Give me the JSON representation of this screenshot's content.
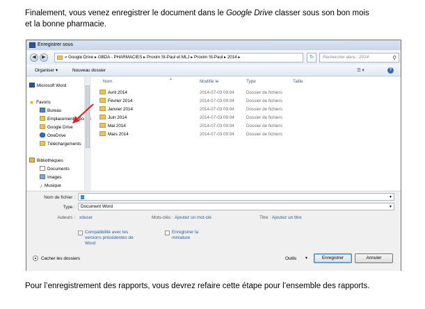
{
  "intro": {
    "line1_a": "Finalement, vous venez enregistrer le document dans le ",
    "line1_em": "Google Drive",
    "line1_b": " classer sous son bon mois",
    "line2": "et la bonne pharmacie."
  },
  "outro": "Pour l’enregistrement des rapports, vous devrez refaire cette étape pour l’ensemble des rapports.",
  "dialog": {
    "title": "Enregistrer sous",
    "address_path": "«  Google Drive  ▸  GBDA - PHARMACIES  ▸  Proxim St-Paul et MLJ  ▸  Proxim St-Paul  ▸  2014  ▸",
    "search_placeholder": "Rechercher dans : 2014",
    "toolbar": {
      "organize": "Organiser ▾",
      "new_folder": "Nouveau dossier"
    },
    "nav": {
      "word": "Microsoft Word",
      "favorites": "Favoris",
      "desktop": "Bureau",
      "recent": "Emplacements récents",
      "gdrive": "Google Drive",
      "onedrive": "OneDrive",
      "downloads": "Téléchargements",
      "libraries": "Bibliothèques",
      "documents": "Documents",
      "images": "Images",
      "music": "Musique"
    },
    "columns": {
      "name": "Nom",
      "modified": "Modifié le",
      "type": "Type",
      "size": "Taille"
    },
    "files": [
      {
        "name": "Avril 2014",
        "modified": "2014-07-03 09:04",
        "type": "Dossier de fichiers"
      },
      {
        "name": "Février 2014",
        "modified": "2014-07-03 09:04",
        "type": "Dossier de fichiers"
      },
      {
        "name": "Janvier 2014",
        "modified": "2014-07-03 09:04",
        "type": "Dossier de fichiers"
      },
      {
        "name": "Juin 2014",
        "modified": "2014-07-03 09:04",
        "type": "Dossier de fichiers"
      },
      {
        "name": "Mai 2014",
        "modified": "2014-07-03 09:04",
        "type": "Dossier de fichiers"
      },
      {
        "name": "Mars 2014",
        "modified": "2014-07-03 09:04",
        "type": "Dossier de fichiers"
      }
    ],
    "form": {
      "filename_label": "Nom de fichier :",
      "type_label": "Type :",
      "type_value": "Document Word",
      "authors_label": "Auteurs :",
      "authors_value": "xduser",
      "keywords_label": "Mots-clés :",
      "keywords_value": "Ajoutez un mot-clé",
      "title_label": "Titre :",
      "title_value": "Ajoutez un titre",
      "cb1": "Compatibilité avec les versions précédentes de Word",
      "cb2": "Enregistrer la miniature"
    },
    "bottom": {
      "hide_folders": "Cacher les dossiers",
      "tools": "Outils",
      "save": "Enregistrer",
      "cancel": "Annuler"
    }
  },
  "colors": {
    "link": "#2a5f9e",
    "arrow": "#e02020",
    "folder": "#e9c25a"
  }
}
